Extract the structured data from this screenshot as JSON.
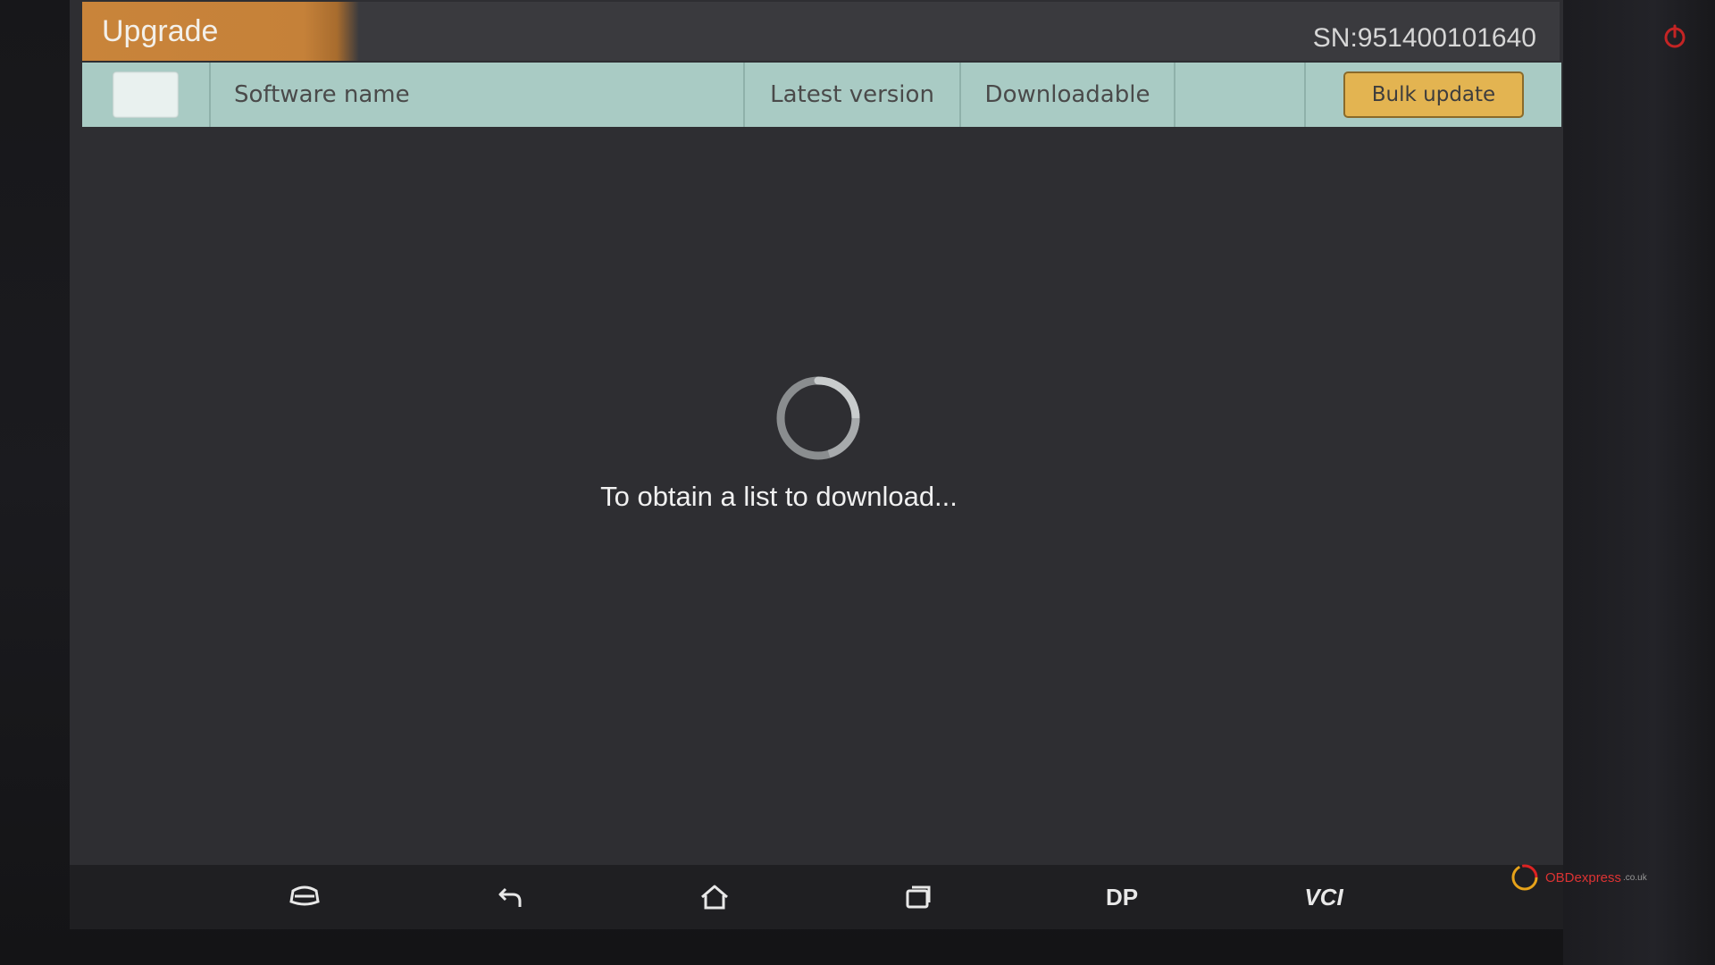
{
  "header": {
    "title": "Upgrade",
    "serial": "SN:951400101640"
  },
  "table_header": {
    "software_name": "Software name",
    "latest_version": "Latest version",
    "downloadable": "Downloadable",
    "bulk_update": "Bulk update"
  },
  "loading": {
    "message": "To obtain a list to download..."
  },
  "nav": {
    "items": [
      {
        "icon": "car-icon"
      },
      {
        "icon": "back-icon"
      },
      {
        "icon": "home-icon"
      },
      {
        "icon": "recent-apps-icon"
      },
      {
        "label": "DP"
      },
      {
        "label": "VCI"
      }
    ]
  },
  "watermark": {
    "brand": "OBDexpress",
    "suffix": ".co.uk"
  },
  "colors": {
    "title_tab": "#c9843a",
    "table_header": "#a9cbc4",
    "bulk_button": "#e3b451",
    "screen_bg": "#2e2e32",
    "power_icon": "#c42424"
  }
}
